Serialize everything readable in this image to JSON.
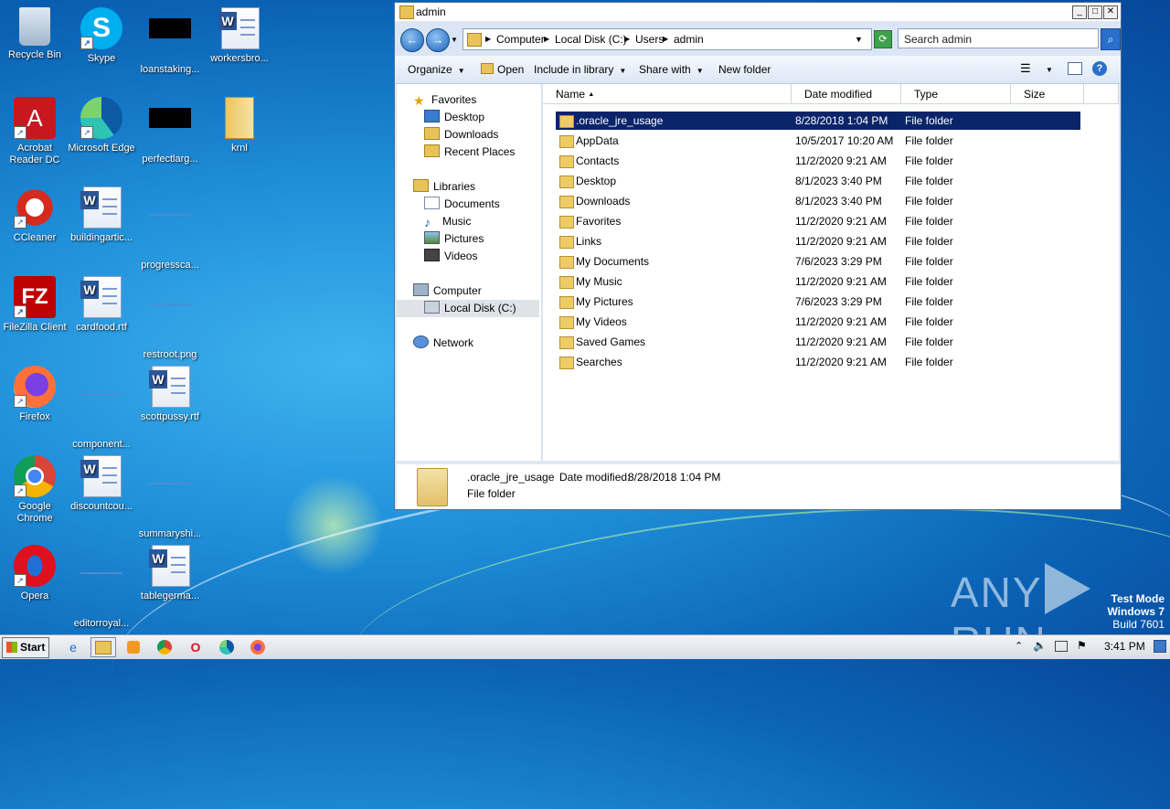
{
  "desktop": {
    "icons": [
      {
        "label": "Recycle Bin"
      },
      {
        "label": "Skype"
      },
      {
        "label": "loanstaking..."
      },
      {
        "label": "workersbro..."
      },
      {
        "label": "Acrobat Reader DC"
      },
      {
        "label": "Microsoft Edge"
      },
      {
        "label": "perfectlarg..."
      },
      {
        "label": "krnl"
      },
      {
        "label": "CCleaner"
      },
      {
        "label": "buildingartic..."
      },
      {
        "label": "progressca..."
      },
      {
        "label": "FileZilla Client"
      },
      {
        "label": "cardfood.rtf"
      },
      {
        "label": "restroot.png"
      },
      {
        "label": "Firefox"
      },
      {
        "label": "component..."
      },
      {
        "label": "scottpussy.rtf"
      },
      {
        "label": "Google Chrome"
      },
      {
        "label": "discountcou..."
      },
      {
        "label": "summaryshi..."
      },
      {
        "label": "Opera"
      },
      {
        "label": "editorroyal..."
      },
      {
        "label": "tablegerma..."
      }
    ]
  },
  "window": {
    "title": "admin",
    "breadcrumbs": [
      "Computer",
      "Local Disk (C:)",
      "Users",
      "admin"
    ],
    "search_placeholder": "Search admin",
    "toolbar": {
      "organize": "Organize",
      "open": "Open",
      "include": "Include in library",
      "share": "Share with",
      "new_folder": "New folder"
    },
    "nav": {
      "favorites": "Favorites",
      "desktop": "Desktop",
      "downloads": "Downloads",
      "recent": "Recent Places",
      "libraries": "Libraries",
      "documents": "Documents",
      "music": "Music",
      "pictures": "Pictures",
      "videos": "Videos",
      "computer": "Computer",
      "local_disk": "Local Disk (C:)",
      "network": "Network"
    },
    "columns": {
      "name": "Name",
      "date": "Date modified",
      "type": "Type",
      "size": "Size"
    },
    "files": [
      {
        "name": ".oracle_jre_usage",
        "date": "8/28/2018 1:04 PM",
        "type": "File folder"
      },
      {
        "name": "AppData",
        "date": "10/5/2017 10:20 AM",
        "type": "File folder"
      },
      {
        "name": "Contacts",
        "date": "11/2/2020 9:21 AM",
        "type": "File folder"
      },
      {
        "name": "Desktop",
        "date": "8/1/2023 3:40 PM",
        "type": "File folder"
      },
      {
        "name": "Downloads",
        "date": "8/1/2023 3:40 PM",
        "type": "File folder"
      },
      {
        "name": "Favorites",
        "date": "11/2/2020 9:21 AM",
        "type": "File folder"
      },
      {
        "name": "Links",
        "date": "11/2/2020 9:21 AM",
        "type": "File folder"
      },
      {
        "name": "My Documents",
        "date": "7/6/2023 3:29 PM",
        "type": "File folder"
      },
      {
        "name": "My Music",
        "date": "11/2/2020 9:21 AM",
        "type": "File folder"
      },
      {
        "name": "My Pictures",
        "date": "7/6/2023 3:29 PM",
        "type": "File folder"
      },
      {
        "name": "My Videos",
        "date": "11/2/2020 9:21 AM",
        "type": "File folder"
      },
      {
        "name": "Saved Games",
        "date": "11/2/2020 9:21 AM",
        "type": "File folder"
      },
      {
        "name": "Searches",
        "date": "11/2/2020 9:21 AM",
        "type": "File folder"
      }
    ],
    "details": {
      "name": ".oracle_jre_usage",
      "date_label": "Date modified:",
      "date": "8/28/2018 1:04 PM",
      "type": "File folder"
    }
  },
  "watermark": {
    "left": "ANY",
    "right": "RUN"
  },
  "os_info": {
    "line1": "Test Mode",
    "line2": "Windows 7",
    "line3": "Build 7601"
  },
  "taskbar": {
    "start": "Start",
    "clock": "3:41 PM"
  }
}
